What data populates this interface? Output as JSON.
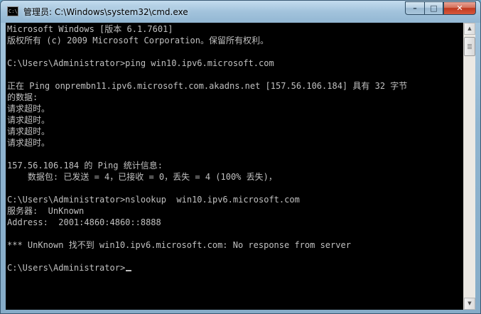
{
  "window": {
    "title": "管理员: C:\\Windows\\system32\\cmd.exe",
    "icon_label": "C:\\",
    "buttons": {
      "minimize_glyph": "–",
      "maximize_glyph": "□",
      "close_glyph": "✕"
    }
  },
  "console": {
    "lines": [
      "Microsoft Windows [版本 6.1.7601]",
      "版权所有 (c) 2009 Microsoft Corporation。保留所有权利。",
      "",
      "C:\\Users\\Administrator>ping win10.ipv6.microsoft.com",
      "",
      "正在 Ping onprembn11.ipv6.microsoft.com.akadns.net [157.56.106.184] 具有 32 字节",
      "的数据:",
      "请求超时。",
      "请求超时。",
      "请求超时。",
      "请求超时。",
      "",
      "157.56.106.184 的 Ping 统计信息:",
      "    数据包: 已发送 = 4，已接收 = 0，丢失 = 4 (100% 丢失)，",
      "",
      "C:\\Users\\Administrator>nslookup  win10.ipv6.microsoft.com",
      "服务器:  UnKnown",
      "Address:  2001:4860:4860::8888",
      "",
      "*** UnKnown 找不到 win10.ipv6.microsoft.com: No response from server",
      "",
      "C:\\Users\\Administrator>"
    ]
  },
  "scrollbar": {
    "up_glyph": "▲",
    "down_glyph": "▼"
  },
  "colors": {
    "console_background": "#000000",
    "console_text": "#c0c0c0",
    "close_button": "#c0391f"
  }
}
